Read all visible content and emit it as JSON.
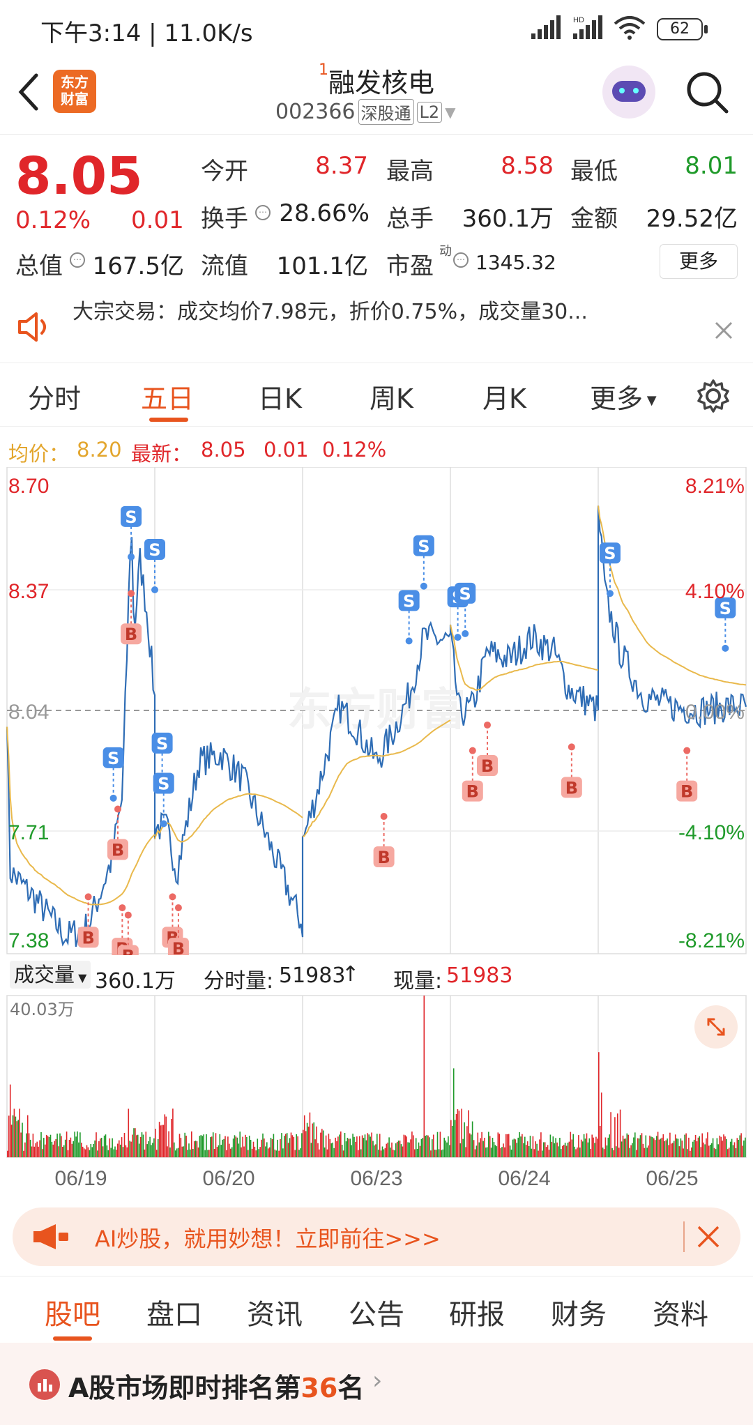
{
  "status_bar": {
    "time": "下午3:14 | 11.0K/s",
    "battery": "62"
  },
  "header": {
    "logo_line1": "东方",
    "logo_line2": "财富",
    "title_sup": "1",
    "title": "融发核电",
    "code": "002366",
    "badge1": "深股通",
    "badge2": "L2"
  },
  "quote": {
    "price": "8.05",
    "change_pct": "0.12%",
    "change": "0.01",
    "open_label": "今开",
    "open": "8.37",
    "high_label": "最高",
    "high": "8.58",
    "low_label": "最低",
    "low": "8.01",
    "turnover_label": "换手",
    "turnover": "28.66%",
    "volume_label": "总手",
    "volume": "360.1万",
    "amount_label": "金额",
    "amount": "29.52亿",
    "mcap_label": "总值",
    "mcap": "167.5亿",
    "float_label": "流值",
    "float": "101.1亿",
    "pe_label": "市盈",
    "pe_sup": "动",
    "pe": "1345.32",
    "more_button": "更多"
  },
  "notice": {
    "text": "大宗交易：成交均价7.98元，折价0.75%，成交量30..."
  },
  "tabs": {
    "items": [
      "分时",
      "五日",
      "日K",
      "周K",
      "月K",
      "更多"
    ],
    "active": "五日"
  },
  "chart_info": {
    "avg_label": "均价：",
    "avg": "8.20",
    "latest_label": "最新：",
    "latest": "8.05",
    "latest_change": "0.01",
    "latest_pct": "0.12%"
  },
  "chart_data": {
    "type": "line",
    "price_axis": {
      "ticks": [
        "8.70",
        "8.37",
        "8.04",
        "7.71",
        "7.38"
      ],
      "ylim": [
        7.38,
        8.7
      ],
      "base": 8.04
    },
    "pct_axis": {
      "ticks": [
        "8.21%",
        "4.10%",
        "0.00%",
        "-4.10%",
        "-8.21%"
      ]
    },
    "x_labels": [
      "06/19",
      "06/20",
      "06/23",
      "06/24",
      "06/25"
    ],
    "watermark": "东方财富",
    "series": [
      {
        "name": "price",
        "color": "#2f6db5"
      },
      {
        "name": "avg",
        "color": "#e9b94c"
      }
    ],
    "markers": [
      {
        "type": "B",
        "day": 0,
        "t": 0.55,
        "price": 7.53
      },
      {
        "type": "B",
        "day": 0,
        "t": 0.75,
        "price": 7.77
      },
      {
        "type": "B",
        "day": 0,
        "t": 0.78,
        "price": 7.5
      },
      {
        "type": "B",
        "day": 0,
        "t": 0.82,
        "price": 7.48
      },
      {
        "type": "S",
        "day": 0,
        "t": 0.72,
        "price": 7.8
      },
      {
        "type": "S",
        "day": 0,
        "t": 0.84,
        "price": 8.46
      },
      {
        "type": "B",
        "day": 0,
        "t": 0.84,
        "price": 8.36
      },
      {
        "type": "S",
        "day": 0,
        "t": 1.0,
        "price": 8.37
      },
      {
        "type": "S",
        "day": 1,
        "t": 0.05,
        "price": 7.84
      },
      {
        "type": "S",
        "day": 1,
        "t": 0.06,
        "price": 7.73
      },
      {
        "type": "B",
        "day": 1,
        "t": 0.12,
        "price": 7.53
      },
      {
        "type": "B",
        "day": 1,
        "t": 0.16,
        "price": 7.5
      },
      {
        "type": "B",
        "day": 2,
        "t": 0.55,
        "price": 7.75
      },
      {
        "type": "S",
        "day": 2,
        "t": 0.72,
        "price": 8.23
      },
      {
        "type": "S",
        "day": 2,
        "t": 0.82,
        "price": 8.38
      },
      {
        "type": "B",
        "day": 3,
        "t": 0.15,
        "price": 7.93
      },
      {
        "type": "B",
        "day": 3,
        "t": 0.25,
        "price": 8.0
      },
      {
        "type": "S",
        "day": 3,
        "t": 0.05,
        "price": 8.24
      },
      {
        "type": "S",
        "day": 3,
        "t": 0.1,
        "price": 8.25
      },
      {
        "type": "B",
        "day": 3,
        "t": 0.82,
        "price": 7.94
      },
      {
        "type": "S",
        "day": 4,
        "t": 0.08,
        "price": 8.36
      },
      {
        "type": "B",
        "day": 4,
        "t": 0.6,
        "price": 7.93
      },
      {
        "type": "S",
        "day": 4,
        "t": 0.86,
        "price": 8.21
      }
    ]
  },
  "volume": {
    "label": "成交量",
    "total": "360.1万",
    "tick_label": "分时量:",
    "tick_value": "51983",
    "now_label": "现量:",
    "now_value": "51983",
    "max_label": "40.03万"
  },
  "promo": {
    "text": "AI炒股，就用妙想！立即前往>>>"
  },
  "bottom_tabs": {
    "items": [
      "股吧",
      "盘口",
      "资讯",
      "公告",
      "研报",
      "财务",
      "资料"
    ],
    "active": "股吧"
  },
  "rank": {
    "prefix": "A股市场即时排名第",
    "num": "36",
    "suffix": "名"
  },
  "colors": {
    "up": "#e0262a",
    "down": "#1f9a2a",
    "accent": "#e8541e",
    "line": "#2f6db5",
    "avg": "#e9b94c"
  }
}
